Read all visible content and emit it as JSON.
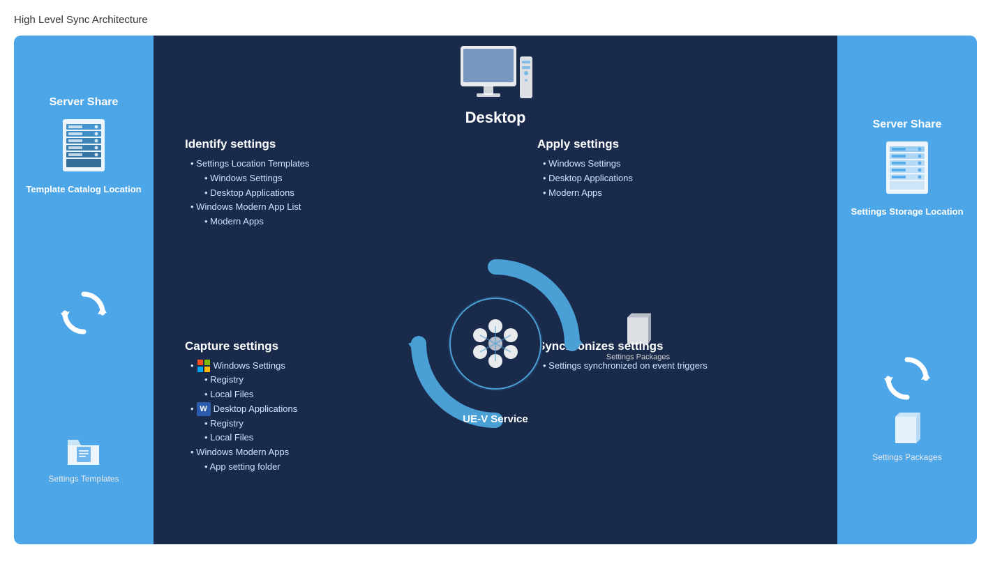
{
  "page": {
    "title": "High Level Sync Architecture"
  },
  "leftShare": {
    "title": "Server Share",
    "topLabel": "Template Catalog Location",
    "bottomLabel": "Settings Templates"
  },
  "rightShare": {
    "title": "Server Share",
    "topLabel": "Settings Storage Location",
    "bottomLabel": "Settings Packages"
  },
  "center": {
    "desktopTitle": "Desktop",
    "identifyTitle": "Identify settings",
    "identify": [
      {
        "text": "Settings Location Templates",
        "level": 1
      },
      {
        "text": "Windows Settings",
        "level": 2
      },
      {
        "text": "Desktop Applications",
        "level": 2
      },
      {
        "text": "Windows Modern App List",
        "level": 1
      },
      {
        "text": "Modern Apps",
        "level": 2
      }
    ],
    "applyTitle": "Apply settings",
    "apply": [
      {
        "text": "Windows Settings",
        "level": 1
      },
      {
        "text": "Desktop Applications",
        "level": 1
      },
      {
        "text": "Modern Apps",
        "level": 1
      }
    ],
    "captureTitle": "Capture settings",
    "capture": [
      {
        "text": "Windows Settings",
        "level": 1
      },
      {
        "text": "Registry",
        "level": 2
      },
      {
        "text": "Local Files",
        "level": 2
      },
      {
        "text": "Desktop Applications",
        "level": 1
      },
      {
        "text": "Registry",
        "level": 2
      },
      {
        "text": "Local Files",
        "level": 2
      },
      {
        "text": "Windows Modern Apps",
        "level": 1
      },
      {
        "text": "App setting folder",
        "level": 2
      }
    ],
    "syncTitle": "Synchronizes settings",
    "sync": [
      {
        "text": "Settings synchronized on event triggers",
        "level": 1
      }
    ],
    "serviceLabel": "UE-V Service",
    "settingsPackagesLabel": "Settings Packages"
  }
}
